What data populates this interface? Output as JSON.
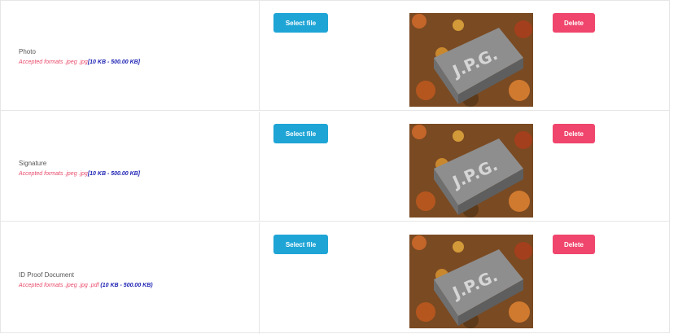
{
  "rows": [
    {
      "label": "Photo",
      "formats": "Accepted formats .jpeg .jpg",
      "size": "[10 KB - 500.00 KB]",
      "select_label": "Select file",
      "delete_label": "Delete",
      "thumbnail_text": "J.P.G."
    },
    {
      "label": "Signature",
      "formats": "Accepted formats .jpeg .jpg",
      "size": "[10 KB - 500.00 KB]",
      "select_label": "Select file",
      "delete_label": "Delete",
      "thumbnail_text": "J.P.G."
    },
    {
      "label": "ID Proof Document",
      "formats": "Accepted formats .jpeg .jpg .pdf",
      "size": "(10 KB - 500.00 KB)",
      "select_label": "Select file",
      "delete_label": "Delete",
      "thumbnail_text": "J.P.G."
    }
  ],
  "colors": {
    "select_button": "#1ea5d6",
    "delete_button": "#f0456c",
    "formats_text": "#e84a6a",
    "size_text": "#1a1fb3"
  }
}
